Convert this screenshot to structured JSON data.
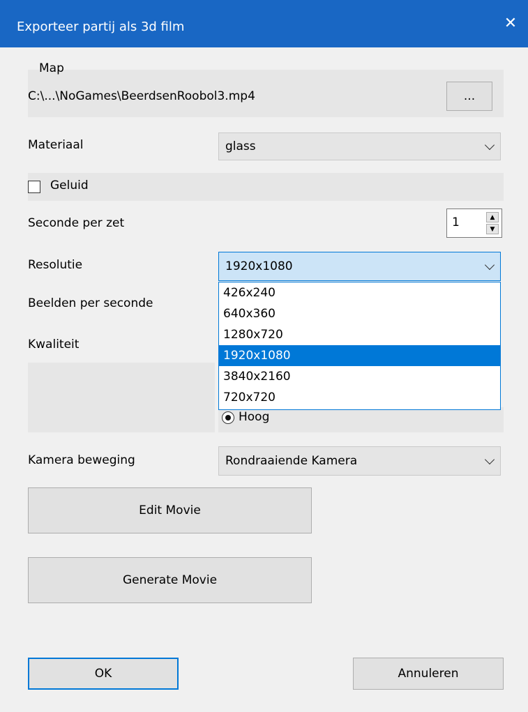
{
  "window": {
    "title": "Exporteer partij als 3d film",
    "close_glyph": "✕"
  },
  "map": {
    "label": "Map",
    "path": "C:\\...\\NoGames\\BeerdsenRoobol3.mp4",
    "browse_label": "..."
  },
  "material": {
    "label": "Materiaal",
    "value": "glass"
  },
  "sound": {
    "label": "Geluid",
    "checked": false
  },
  "seconds": {
    "label": "Seconde per zet",
    "value": "1"
  },
  "resolution": {
    "label": "Resolutie",
    "value": "1920x1080",
    "options": [
      "426x240",
      "640x360",
      "1280x720",
      "1920x1080",
      "3840x2160",
      "720x720"
    ],
    "selected_index": 3
  },
  "fps": {
    "label": "Beelden per seconde"
  },
  "quality": {
    "label": "Kwaliteit",
    "visible_option": "Hoog",
    "visible_option_selected": true
  },
  "camera": {
    "label": "Kamera beweging",
    "value": "Rondraaiende Kamera"
  },
  "buttons": {
    "edit": "Edit Movie",
    "generate": "Generate Movie",
    "ok": "OK",
    "cancel": "Annuleren"
  },
  "colors": {
    "titlebar": "#1967c4",
    "accent": "#0078d7",
    "background": "#f0f0f0"
  }
}
